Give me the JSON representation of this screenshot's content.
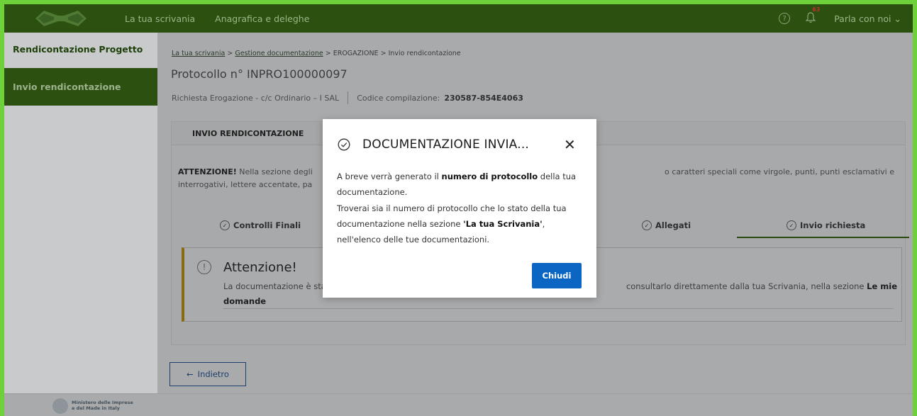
{
  "topbar": {
    "nav": [
      "La tua scrivania",
      "Anagrafica e deleghe"
    ],
    "notifications_count": "63",
    "talk_label": "Parla con noi",
    "talk_chevron": "⌄"
  },
  "sidebar": {
    "title": "Rendicontazione Progetto",
    "items": [
      {
        "label": "Invio rendicontazione"
      }
    ]
  },
  "breadcrumb": {
    "items": [
      "La tua scrivania",
      "Gestione documentazione",
      "EROGAZIONE",
      "Invio rendicontazione"
    ],
    "separator": ">"
  },
  "header": {
    "title": "Protocollo n° INPRO100000097",
    "subtitle": "Richiesta Erogazione - c/c Ordinario – I SAL",
    "code_label": "Codice compilazione:",
    "code_value": "230587-854E4063"
  },
  "card": {
    "title": "INVIO RENDICONTAZIONE",
    "warning_bold": "ATTENZIONE!",
    "warning_left_1": " Nella sezione degli",
    "warning_right_1": "o caratteri speciali come virgole, punti, punti esclamativi e",
    "warning_left_2": "interrogativi, lettere accentate, pa",
    "tabs": [
      {
        "label": "Controlli Finali"
      },
      {
        "label": "Allegati"
      },
      {
        "label": "Invio richiesta"
      }
    ]
  },
  "alert": {
    "title": "Attenzione!",
    "left_text": "La documentazione è sta",
    "right_text": "consultarlo direttamente dalla tua Scrivania, nella sezione ",
    "link_text": "Le mie",
    "link_text_2": "domande"
  },
  "back_button": {
    "label": "Indietro",
    "arrow": "←"
  },
  "footer": {
    "line1": "Ministero delle Imprese",
    "line2": "e del Made in Italy"
  },
  "modal": {
    "title": "DOCUMENTAZIONE INVIA...",
    "close": "✕",
    "body_1": "A breve verrà generato il ",
    "body_bold_1": "numero di protocollo",
    "body_2": " della tua documentazione.",
    "body_3": "Troverai sia il numero di protocollo che lo stato della tua documentazione nella sezione ",
    "body_bold_2": "'La tua Scrivania'",
    "body_4": ", nell'elenco delle tue documentazioni.",
    "button": "Chiudi"
  },
  "colors": {
    "frame_border": "#6fd13a",
    "topbar": "#2b5010",
    "primary_button": "#0a66c2"
  }
}
